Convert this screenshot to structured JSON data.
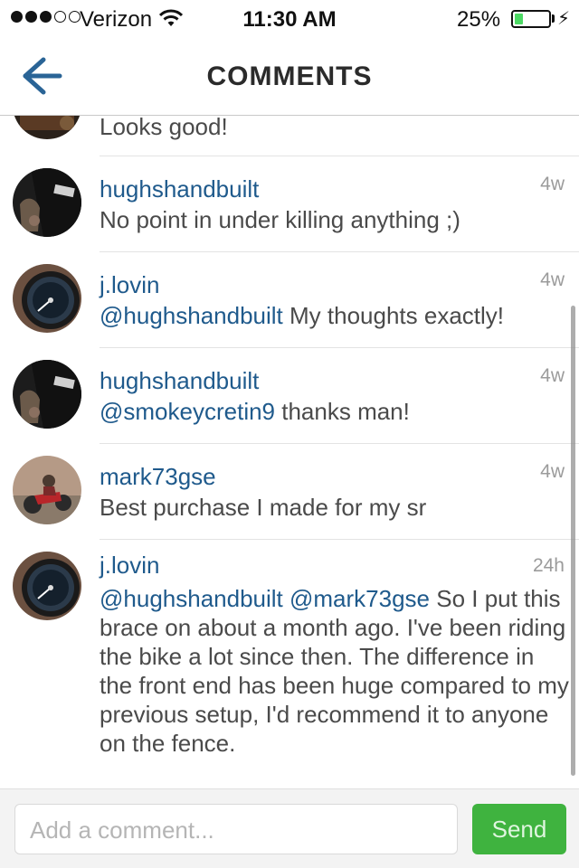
{
  "status": {
    "carrier": "Verizon",
    "time": "11:30 AM",
    "battery": "25%",
    "battery_level": 0.25,
    "signal_bars": 3,
    "signal_max": 5
  },
  "nav": {
    "title": "COMMENTS",
    "back_icon": "back-arrow-icon"
  },
  "comments": [
    {
      "user": "",
      "age": "",
      "text": "Looks good!"
    },
    {
      "user": "hughshandbuilt",
      "age": "4w",
      "text": "No point in under killing anything ;)"
    },
    {
      "user": "j.lovin",
      "age": "4w",
      "mention": "@hughshandbuilt",
      "text": " My thoughts exactly!"
    },
    {
      "user": "hughshandbuilt",
      "age": "4w",
      "mention": "@smokeycretin9",
      "text": " thanks man!"
    },
    {
      "user": "mark73gse",
      "age": "4w",
      "text": "Best purchase I made for my sr"
    },
    {
      "user": "j.lovin",
      "age": "24h",
      "mention": "@hughshandbuilt @mark73gse",
      "text": " So I put this brace on about a month ago.  I've been riding the bike a lot since then. The difference in the front end has been huge compared to my previous setup, I'd recommend it to anyone on the fence."
    }
  ],
  "composer": {
    "placeholder": "Add a comment...",
    "send_label": "Send"
  },
  "colors": {
    "link": "#1f5a8c",
    "send": "#3fb33f",
    "battery": "#4cd964",
    "back_arrow": "#2a6496"
  }
}
